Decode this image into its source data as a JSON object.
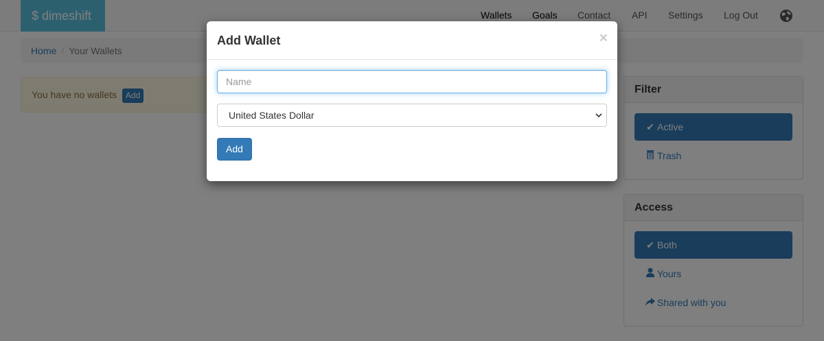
{
  "navbar": {
    "brand": "$ dimeshift",
    "links": [
      {
        "label": "Wallets"
      },
      {
        "label": "Goals"
      },
      {
        "label": "Contact"
      },
      {
        "label": "API"
      },
      {
        "label": "Settings"
      },
      {
        "label": "Log Out"
      }
    ],
    "globe_icon": "globe-icon"
  },
  "breadcrumb": {
    "home": "Home",
    "separator": "/",
    "current": "Your Wallets"
  },
  "alert": {
    "text": "You have no wallets",
    "add_label": "Add"
  },
  "filter_panel": {
    "title": "Filter",
    "items": [
      {
        "label": "Active",
        "icon": "check-icon",
        "active": true
      },
      {
        "label": "Trash",
        "icon": "trash-icon",
        "active": false
      }
    ]
  },
  "access_panel": {
    "title": "Access",
    "items": [
      {
        "label": "Both",
        "icon": "check-icon",
        "active": true
      },
      {
        "label": "Yours",
        "icon": "user-icon",
        "active": false
      },
      {
        "label": "Shared with you",
        "icon": "share-icon",
        "active": false
      }
    ]
  },
  "modal": {
    "title": "Add Wallet",
    "close_label": "×",
    "name_placeholder": "Name",
    "currency_selected": "United States Dollar",
    "submit_label": "Add"
  },
  "colors": {
    "brand": "#5bc0de",
    "primary": "#337ab7",
    "alert_bg": "#fcf8e3",
    "alert_text": "#8a6d3b"
  }
}
